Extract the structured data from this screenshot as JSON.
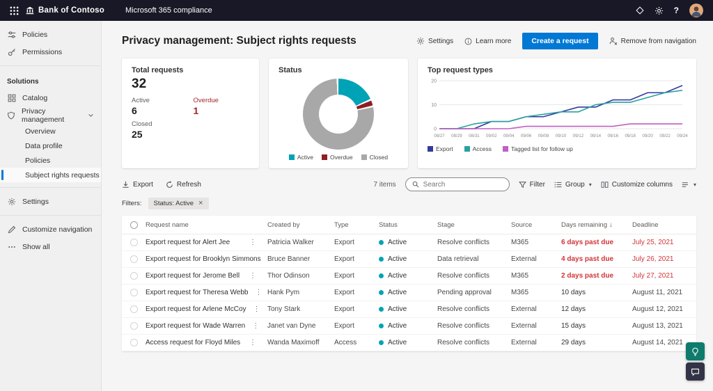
{
  "colors": {
    "accent": "#0078d4",
    "active_teal": "#00a3b5",
    "overdue_dark_red": "#a4262c",
    "alert_red": "#d13438",
    "closed_gray": "#a8a8a8"
  },
  "topbar": {
    "brand": "Bank of Contoso",
    "app_title": "Microsoft 365 compliance"
  },
  "sidebar": {
    "policies": "Policies",
    "permissions": "Permissions",
    "solutions_header": "Solutions",
    "catalog": "Catalog",
    "privacy_management": "Privacy management",
    "overview": "Overview",
    "data_profile": "Data profile",
    "policies_child": "Policies",
    "subject_rights": "Subject rights requests",
    "settings": "Settings",
    "customize_navigation": "Customize navigation",
    "show_all": "Show all"
  },
  "header": {
    "title": "Privacy management: Subject rights requests",
    "settings": "Settings",
    "learn_more": "Learn more",
    "create_request": "Create a request",
    "remove_from_navigation": "Remove from navigation"
  },
  "cards": {
    "total": {
      "title": "Total requests",
      "value": "32",
      "active_label": "Active",
      "active_value": "6",
      "overdue_label": "Overdue",
      "overdue_value": "1",
      "closed_label": "Closed",
      "closed_value": "25"
    },
    "status": {
      "title": "Status"
    },
    "top_types": {
      "title": "Top request types"
    }
  },
  "chart_data": [
    {
      "type": "pie",
      "donut": true,
      "title": "Status",
      "labels": [
        "Active",
        "Overdue",
        "Closed"
      ],
      "values": [
        6,
        1,
        25
      ],
      "colors": [
        "#00a3b5",
        "#8e1f24",
        "#a8a8a8"
      ],
      "legend_position": "bottom"
    },
    {
      "type": "line",
      "title": "Top request types",
      "x": [
        "08/27",
        "08/29",
        "08/31",
        "09/02",
        "09/04",
        "09/06",
        "09/08",
        "09/10",
        "09/12",
        "09/14",
        "09/16",
        "09/18",
        "09/20",
        "09/22",
        "09/24"
      ],
      "series": [
        {
          "name": "Export",
          "color": "#333a9e",
          "values": [
            0,
            0,
            0,
            3,
            3,
            5,
            5,
            7,
            9,
            9,
            12,
            12,
            15,
            15,
            18
          ]
        },
        {
          "name": "Access",
          "color": "#2aa0a2",
          "values": [
            0,
            0,
            2,
            3,
            3,
            5,
            6,
            7,
            7,
            10,
            11,
            11,
            13,
            15,
            16
          ]
        },
        {
          "name": "Tagged list for follow up",
          "color": "#c05fc5",
          "values": [
            0,
            0,
            0,
            0,
            0,
            1,
            1,
            1,
            1,
            1,
            1,
            2,
            2,
            2,
            2
          ]
        }
      ],
      "ylim": [
        0,
        20
      ],
      "yticks": [
        0,
        10,
        20
      ],
      "grid": true,
      "legend_position": "bottom"
    }
  ],
  "toolbar": {
    "export": "Export",
    "refresh": "Refresh",
    "items_count": "7 items",
    "search_placeholder": "Search",
    "filter": "Filter",
    "group": "Group",
    "customize_columns": "Customize columns"
  },
  "filters": {
    "label": "Filters:",
    "chip": "Status: Active"
  },
  "table": {
    "columns": [
      "Request name",
      "Created by",
      "Type",
      "Status",
      "Stage",
      "Source",
      "Days remaining",
      "Deadline"
    ],
    "sorted_by": "Days remaining",
    "rows": [
      {
        "name": "Export request for Alert Jee",
        "created_by": "Patricia Walker",
        "type": "Export",
        "status": "Active",
        "stage": "Resolve conflicts",
        "source": "M365",
        "days_remaining": "6 days past due",
        "deadline": "July 25, 2021",
        "overdue": true
      },
      {
        "name": "Export request for Brooklyn Simmons",
        "created_by": "Bruce Banner",
        "type": "Export",
        "status": "Active",
        "stage": "Data retrieval",
        "source": "External",
        "days_remaining": "4 days past due",
        "deadline": "July 26, 2021",
        "overdue": true
      },
      {
        "name": "Export request for Jerome Bell",
        "created_by": "Thor Odinson",
        "type": "Export",
        "status": "Active",
        "stage": "Resolve conflicts",
        "source": "M365",
        "days_remaining": "2 days past due",
        "deadline": "July 27, 2021",
        "overdue": true
      },
      {
        "name": "Export request for Theresa Webb",
        "created_by": "Hank Pym",
        "type": "Export",
        "status": "Active",
        "stage": "Pending approval",
        "source": "M365",
        "days_remaining": "10 days",
        "deadline": "August 11, 2021",
        "overdue": false
      },
      {
        "name": "Export request for Arlene McCoy",
        "created_by": "Tony Stark",
        "type": "Export",
        "status": "Active",
        "stage": "Resolve conflicts",
        "source": "External",
        "days_remaining": "12 days",
        "deadline": "August 12, 2021",
        "overdue": false
      },
      {
        "name": "Export request for Wade Warren",
        "created_by": "Janet van Dyne",
        "type": "Export",
        "status": "Active",
        "stage": "Resolve conflicts",
        "source": "External",
        "days_remaining": "15 days",
        "deadline": "August 13, 2021",
        "overdue": false
      },
      {
        "name": "Access request for Floyd Miles",
        "created_by": "Wanda Maximoff",
        "type": "Access",
        "status": "Active",
        "stage": "Resolve conflicts",
        "source": "External",
        "days_remaining": "29 days",
        "deadline": "August 14, 2021",
        "overdue": false
      }
    ]
  }
}
